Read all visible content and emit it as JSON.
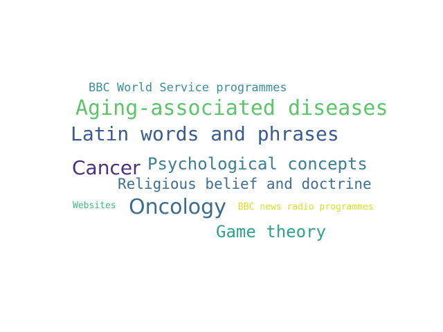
{
  "words": [
    {
      "text": "BBC World Service programmes",
      "color": "#3a8e9b"
    },
    {
      "text": "Aging-associated diseases",
      "color": "#5ec46c"
    },
    {
      "text": "Latin words and phrases",
      "color": "#3b5b8f"
    },
    {
      "text": "Cancer",
      "color": "#46337e"
    },
    {
      "text": "Psychological concepts",
      "color": "#3d7e92"
    },
    {
      "text": "Religious belief and doctrine",
      "color": "#3f6e91"
    },
    {
      "text": "Websites",
      "color": "#3dbb7a"
    },
    {
      "text": "Oncology",
      "color": "#3b6c8e"
    },
    {
      "text": "BBC news radio programmes",
      "color": "#d7e226"
    },
    {
      "text": "Game theory",
      "color": "#2ea28d"
    }
  ]
}
